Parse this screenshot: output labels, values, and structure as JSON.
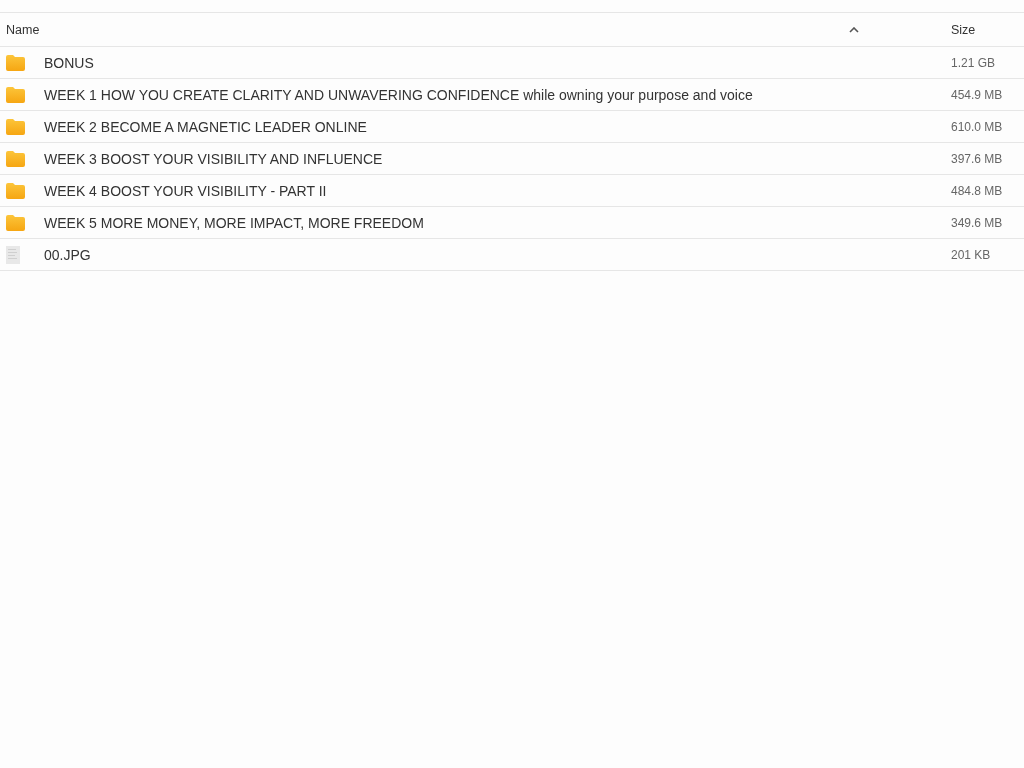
{
  "columns": [
    {
      "label": "Name",
      "sorted": true
    },
    {
      "label": "Size"
    }
  ],
  "rows": [
    {
      "kind": "folder",
      "name": "BONUS",
      "size": "1.21 GB"
    },
    {
      "kind": "folder",
      "name": "WEEK 1 HOW YOU CREATE CLARITY AND UNWAVERING CONFIDENCE while owning your purpose and voice",
      "size": "454.9 MB"
    },
    {
      "kind": "folder",
      "name": "WEEK 2 BECOME A MAGNETIC LEADER ONLINE",
      "size": "610.0 MB"
    },
    {
      "kind": "folder",
      "name": "WEEK 3 BOOST YOUR VISIBILITY AND INFLUENCE",
      "size": "397.6 MB"
    },
    {
      "kind": "folder",
      "name": "WEEK 4 BOOST YOUR VISIBILITY - PART II",
      "size": "484.8 MB"
    },
    {
      "kind": "folder",
      "name": "WEEK 5 MORE MONEY, MORE IMPACT, MORE FREEDOM",
      "size": "349.6 MB"
    },
    {
      "kind": "file",
      "name": "00.JPG",
      "size": "201 KB"
    }
  ]
}
